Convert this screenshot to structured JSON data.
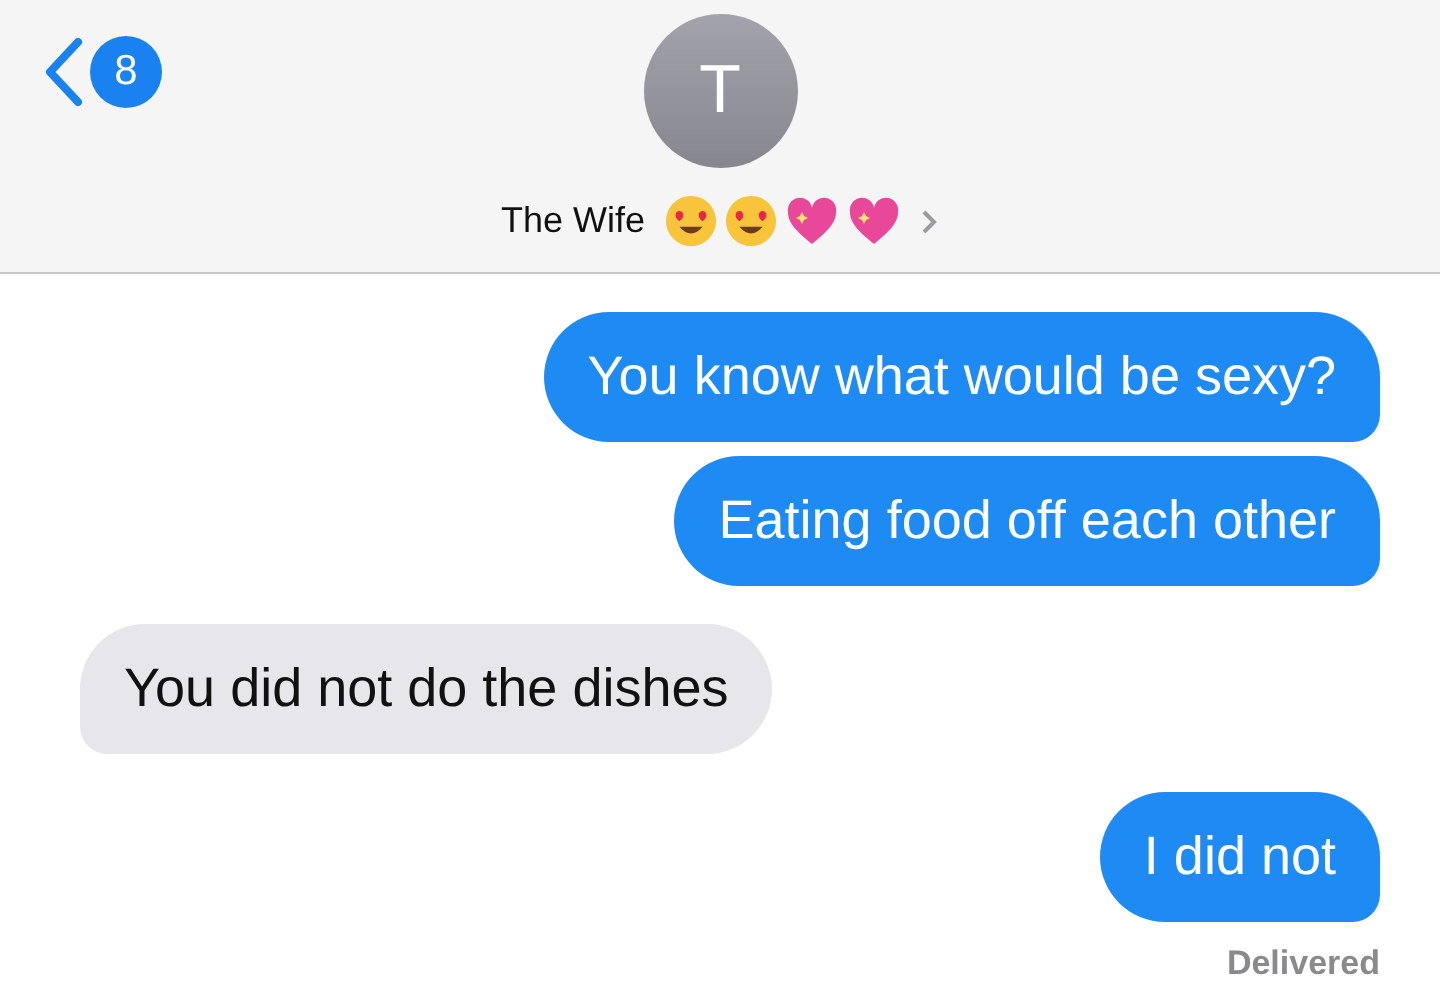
{
  "header": {
    "back_badge": "8",
    "avatar_initial": "T",
    "contact_name": "The Wife"
  },
  "messages": [
    {
      "kind": "sent",
      "text": "You know what would be sexy?"
    },
    {
      "kind": "sent",
      "text": "Eating food off each other"
    },
    {
      "kind": "received",
      "text": "You did not do the dishes"
    },
    {
      "kind": "sent",
      "text": "I did not"
    }
  ],
  "status": "Delivered"
}
